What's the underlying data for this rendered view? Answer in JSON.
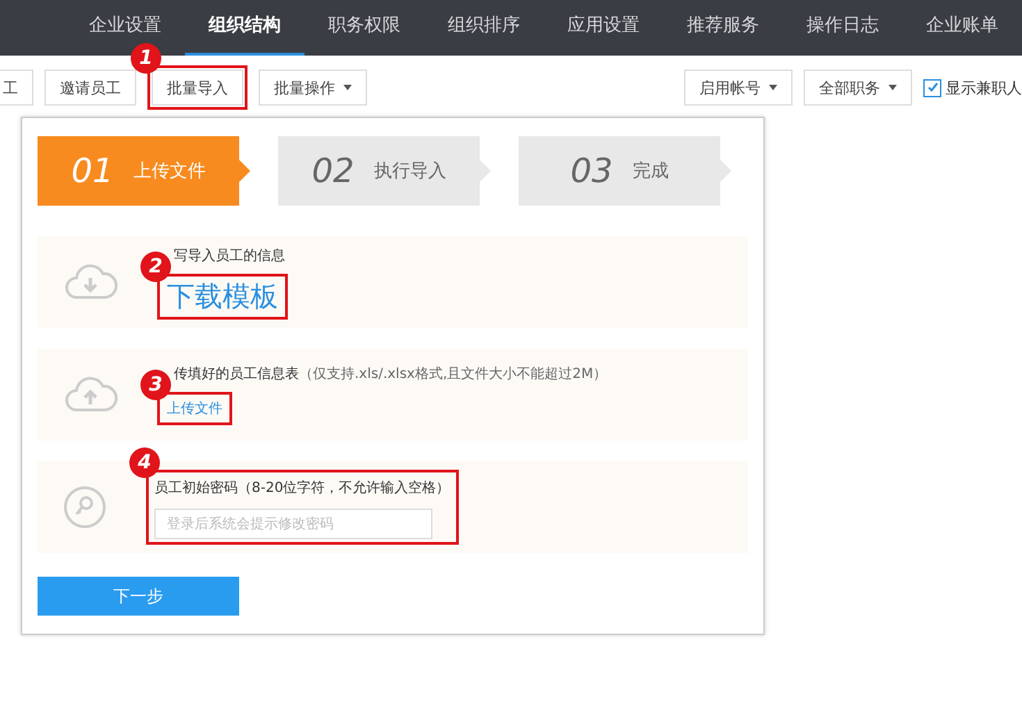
{
  "nav": {
    "items": [
      {
        "label": "企业设置",
        "selected": false
      },
      {
        "label": "组织结构",
        "selected": true
      },
      {
        "label": "职务权限",
        "selected": false
      },
      {
        "label": "组织排序",
        "selected": false
      },
      {
        "label": "应用设置",
        "selected": false
      },
      {
        "label": "推荐服务",
        "selected": false
      },
      {
        "label": "操作日志",
        "selected": false
      },
      {
        "label": "企业账单",
        "selected": false
      }
    ]
  },
  "toolbar": {
    "left": [
      {
        "label": "工",
        "dropdown": false
      },
      {
        "label": "邀请员工",
        "dropdown": false
      },
      {
        "label": "批量导入",
        "dropdown": false,
        "annotation": "1"
      },
      {
        "label": "批量操作",
        "dropdown": true
      }
    ],
    "right": [
      {
        "label": "启用帐号",
        "dropdown": true
      },
      {
        "label": "全部职务",
        "dropdown": true
      }
    ],
    "checkbox": {
      "label": "显示兼职人",
      "checked": true
    }
  },
  "steps": [
    {
      "number": "01",
      "label": "上传文件",
      "selected": true
    },
    {
      "number": "02",
      "label": "执行导入",
      "selected": false
    },
    {
      "number": "03",
      "label": "完成",
      "selected": false
    }
  ],
  "sections": [
    {
      "kind": "download",
      "hint": "写导入员工的信息",
      "link": "下载模板",
      "annotation": "2"
    },
    {
      "kind": "upload",
      "hint": "传填好的员工信息表",
      "note": "（仅支持.xls/.xlsx格式,且文件大小不能超过2M）",
      "link": "上传文件",
      "annotation": "3"
    },
    {
      "kind": "password",
      "label": "员工初始密码（8-20位字符，不允许输入空格）",
      "placeholder": "登录后系统会提示修改密码",
      "annotation": "4"
    }
  ],
  "next_button": "下一步"
}
